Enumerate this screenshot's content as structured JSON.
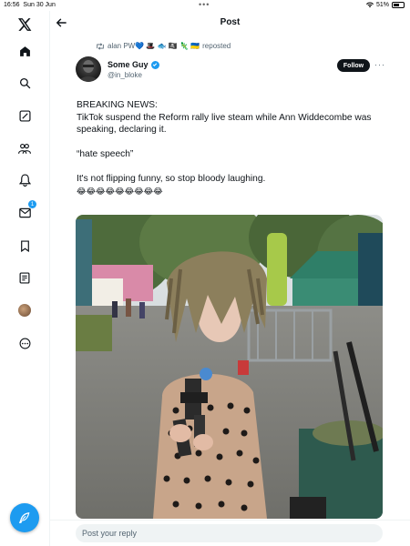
{
  "status_bar": {
    "time": "16:56",
    "date": "Sun 30 Jun",
    "dots": "•••",
    "battery": "51%"
  },
  "sidebar": {
    "items": [
      {
        "name": "x-logo-icon"
      },
      {
        "name": "home-icon"
      },
      {
        "name": "search-icon"
      },
      {
        "name": "compose-grok-icon"
      },
      {
        "name": "communities-icon"
      },
      {
        "name": "notifications-icon"
      },
      {
        "name": "messages-icon",
        "badge": "1"
      },
      {
        "name": "bookmarks-icon"
      },
      {
        "name": "lists-icon"
      },
      {
        "name": "profile-avatar"
      },
      {
        "name": "more-icon"
      }
    ],
    "fab_icon": "feather-icon"
  },
  "header": {
    "title": "Post",
    "back_icon": "arrow-left-icon"
  },
  "post": {
    "repost_by": "alan PW💙 🎩 🐟 🏴‍☠️ 🦎 🇺🇦",
    "repost_suffix": "reposted",
    "author_name": "Some Guy",
    "author_handle": "@in_bloke",
    "follow_label": "Follow",
    "more": "···",
    "text_line1": "BREAKING NEWS:",
    "text_line2": "TikTok suspend the Reform rally live steam while Ann Widdecombe was speaking, declaring it.",
    "text_line3": "“hate speech”",
    "text_line4": "It's not flipping funny, so stop bloody laughing.",
    "text_emoji": "😂😂😂😂😂😂😂😂😂"
  },
  "reply": {
    "placeholder": "Post your reply"
  },
  "colors": {
    "accent": "#1d9bf0",
    "text": "#0f1419",
    "muted": "#536471"
  }
}
